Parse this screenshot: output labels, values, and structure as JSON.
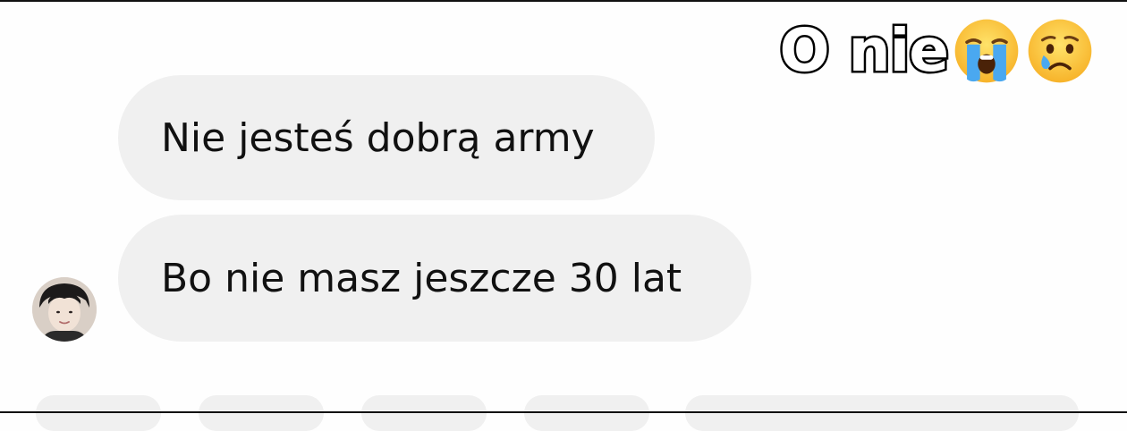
{
  "overlay": {
    "caption": "O nie",
    "emojis": [
      "loudly-crying-face",
      "crying-face"
    ]
  },
  "thread": {
    "messages": [
      {
        "text": "Nie jesteś dobrą army"
      },
      {
        "text": "Bo nie masz jeszcze 30 lat"
      }
    ]
  },
  "colors": {
    "background": "#fefefe",
    "bubble": "#f0f0f0",
    "text": "#111111",
    "emoji_yellow": "#fdc52f",
    "tear_blue": "#4aa8f0"
  }
}
